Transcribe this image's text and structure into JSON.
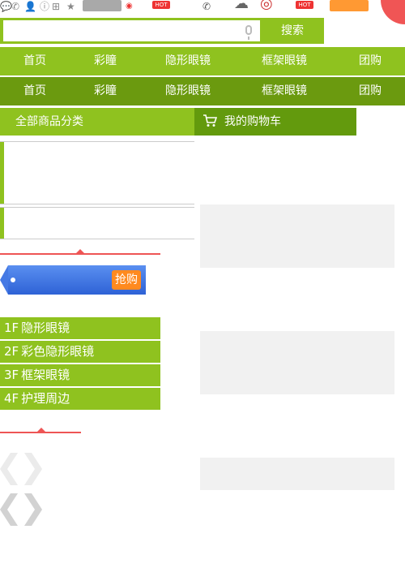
{
  "search": {
    "placeholder": "",
    "value": "",
    "button_label": "搜索"
  },
  "nav_rows": [
    [
      "首页",
      "彩瞳",
      "隐形眼镜",
      "框架眼镜",
      "团购"
    ],
    [
      "首页",
      "彩瞳",
      "隐形眼镜",
      "框架眼镜",
      "团购"
    ]
  ],
  "category": {
    "label": "全部商品分类"
  },
  "cart": {
    "label": "我的购物车"
  },
  "promo": {
    "grab_label": "抢购"
  },
  "floors": [
    {
      "num": "1F",
      "label": "隐形眼镜"
    },
    {
      "num": "2F",
      "label": "彩色隐形眼镜"
    },
    {
      "num": "3F",
      "label": "框架眼镜"
    },
    {
      "num": "4F",
      "label": "护理周边"
    }
  ],
  "badges": {
    "hot": "HOT"
  },
  "colors": {
    "accent": "#8fc21f",
    "nav_dark": "#6b9a0f",
    "cart": "#639a0d",
    "promo": "#3b6fe0",
    "hot": "#e33333",
    "red_line": "#ee5555"
  },
  "icons": [
    "message-icon",
    "phone-icon",
    "user-icon",
    "info-icon",
    "grid-icon",
    "star-icon",
    "wechat-icon",
    "weibo-icon",
    "cart-icon",
    "mic-icon",
    "chevron-left-icon",
    "chevron-right-icon"
  ]
}
